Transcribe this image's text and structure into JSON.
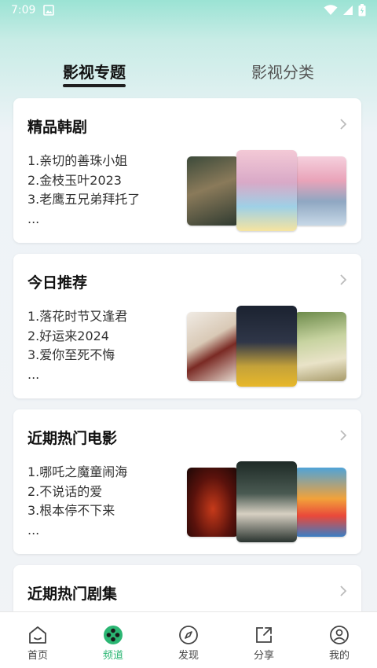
{
  "status_bar": {
    "time": "7:09"
  },
  "tabs": [
    {
      "label": "影视专题",
      "active": true
    },
    {
      "label": "影视分类",
      "active": false
    }
  ],
  "cards": [
    {
      "title": "精品韩剧",
      "items": [
        "1.亲切的善珠小姐",
        "2.金枝玉叶2023",
        "3.老鹰五兄弟拜托了",
        "..."
      ]
    },
    {
      "title": "今日推荐",
      "items": [
        "1.落花时节又逢君",
        "2.好运来2024",
        "3.爱你至死不悔",
        "..."
      ]
    },
    {
      "title": "近期热门电影",
      "items": [
        "1.哪吒之魔童闹海",
        "2.不说话的爱",
        "3.根本停不下来",
        "..."
      ]
    },
    {
      "title": "近期热门剧集",
      "items": []
    }
  ],
  "bottom_nav": [
    {
      "label": "首页",
      "icon": "home-icon",
      "active": false
    },
    {
      "label": "频道",
      "icon": "channel-icon",
      "active": true
    },
    {
      "label": "发现",
      "icon": "compass-icon",
      "active": false
    },
    {
      "label": "分享",
      "icon": "share-icon",
      "active": false
    },
    {
      "label": "我的",
      "icon": "profile-icon",
      "active": false
    }
  ],
  "colors": {
    "accent": "#2bb673",
    "active_tab_underline": "#1f1f1f"
  }
}
